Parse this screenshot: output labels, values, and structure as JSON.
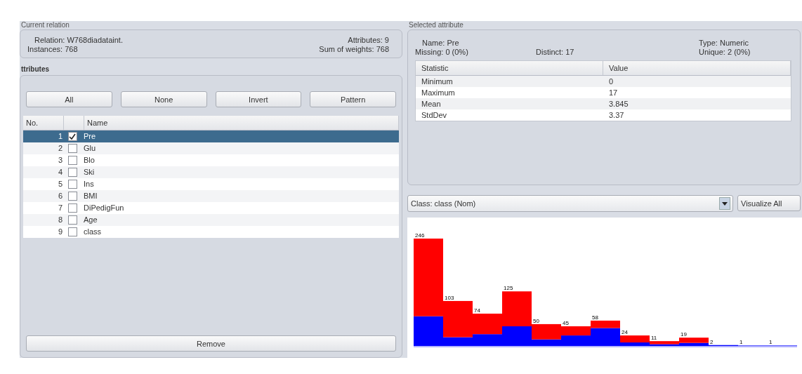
{
  "current_relation": {
    "heading": "Current relation",
    "relation_label": "Relation:",
    "relation": "W768diadataint.",
    "attributes_label": "Attributes:",
    "attributes": "9",
    "instances_label": "Instances:",
    "instances": "768",
    "sum_label": "Sum of weights:",
    "sum": "768"
  },
  "attributes": {
    "heading": "ttributes",
    "buttons": [
      "All",
      "None",
      "Invert",
      "Pattern"
    ],
    "columns": [
      "No.",
      "Name"
    ],
    "rows": [
      {
        "no": "1",
        "name": "Pre",
        "checked": true,
        "selected": true
      },
      {
        "no": "2",
        "name": "Glu",
        "checked": false,
        "selected": false
      },
      {
        "no": "3",
        "name": "Blo",
        "checked": false,
        "selected": false
      },
      {
        "no": "4",
        "name": "Ski",
        "checked": false,
        "selected": false
      },
      {
        "no": "5",
        "name": "Ins",
        "checked": false,
        "selected": false
      },
      {
        "no": "6",
        "name": "BMI",
        "checked": false,
        "selected": false
      },
      {
        "no": "7",
        "name": "DiPedigFun",
        "checked": false,
        "selected": false
      },
      {
        "no": "8",
        "name": "Age",
        "checked": false,
        "selected": false
      },
      {
        "no": "9",
        "name": "class",
        "checked": false,
        "selected": false
      }
    ],
    "remove_button": "Remove"
  },
  "selected_attribute": {
    "heading": "Selected attribute",
    "name_label": "Name:",
    "name": "Pre",
    "type_label": "Type:",
    "type": "Numeric",
    "missing_label": "Missing:",
    "missing": "0 (0%)",
    "distinct_label": "Distinct:",
    "distinct": "17",
    "unique_label": "Unique:",
    "unique": "2 (0%)",
    "columns": [
      "Statistic",
      "Value"
    ],
    "stats": [
      {
        "statistic": "Minimum",
        "value": "0"
      },
      {
        "statistic": "Maximum",
        "value": "17"
      },
      {
        "statistic": "Mean",
        "value": "3.845"
      },
      {
        "statistic": "StdDev",
        "value": "3.37"
      }
    ]
  },
  "class_select": {
    "value": "Class: class (Nom)"
  },
  "visualize_button": "Visualize All",
  "histogram": {
    "bar_labels": [
      "246",
      "103",
      "74",
      "125",
      "50",
      "45",
      "58",
      "24",
      "11",
      "19",
      "2",
      "1",
      "1"
    ]
  }
}
